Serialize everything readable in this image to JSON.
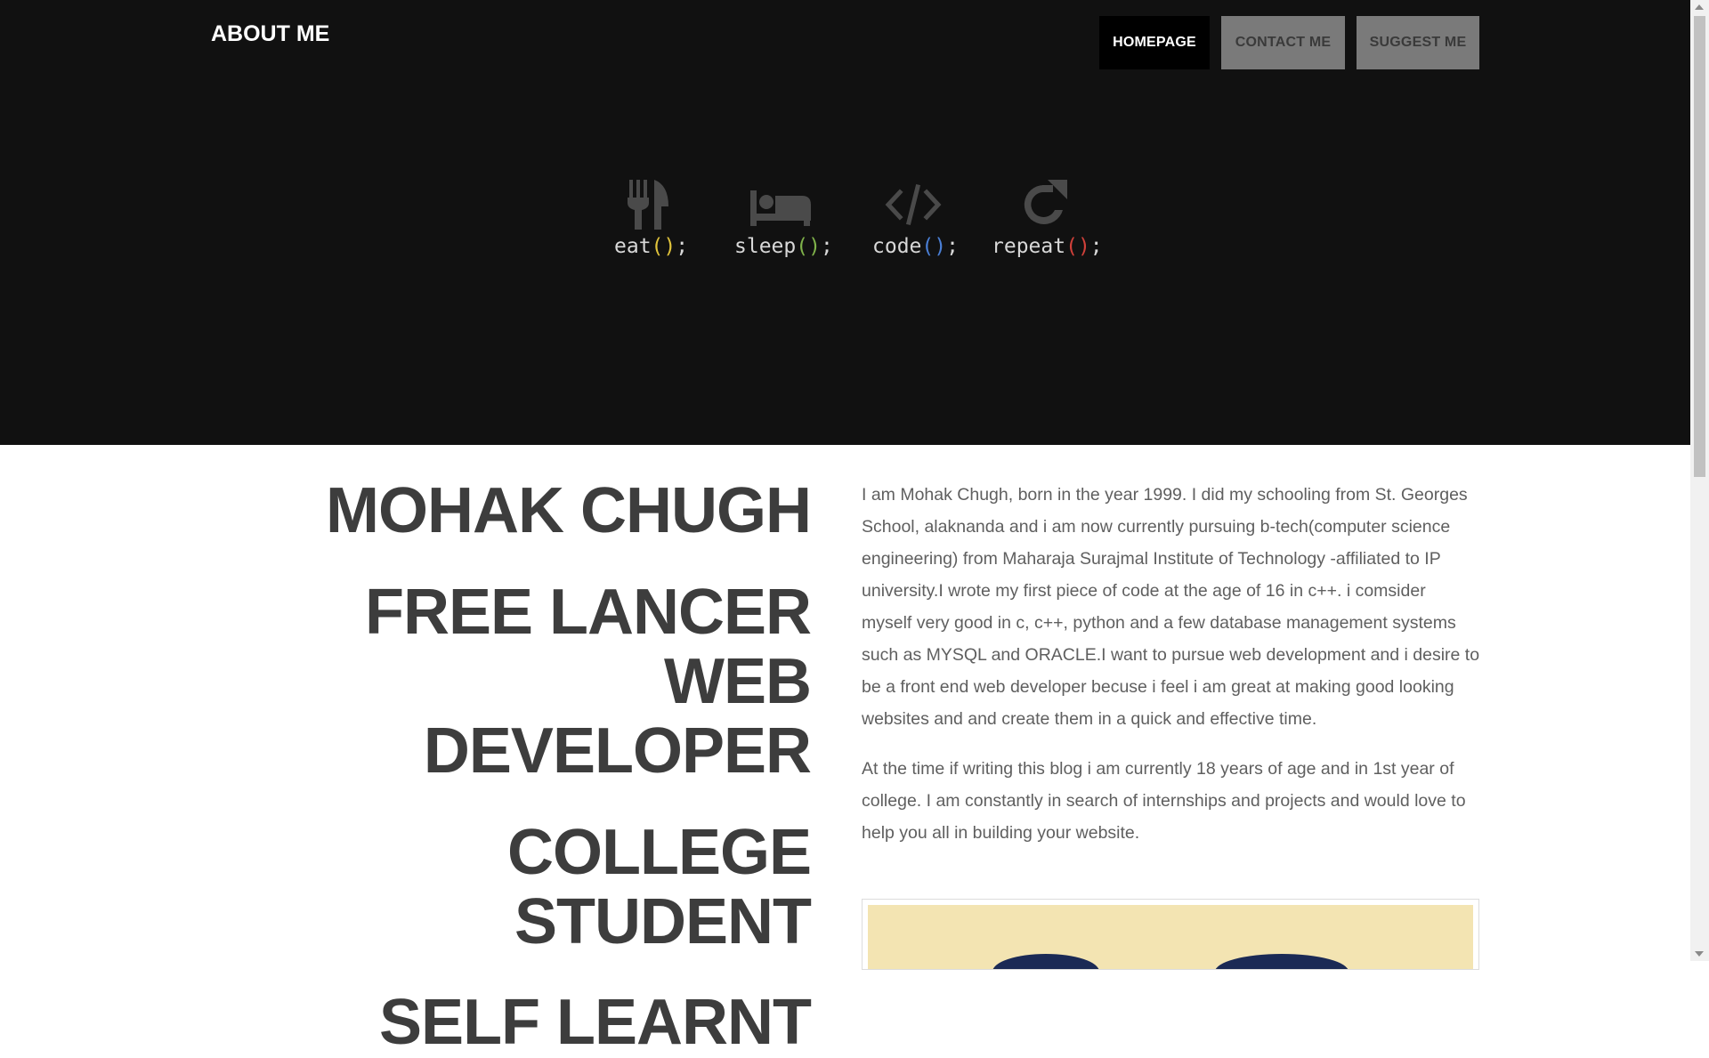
{
  "header": {
    "brand": "ABOUT ME",
    "nav": [
      {
        "label": "HOMEPAGE"
      },
      {
        "label": "CONTACT ME"
      },
      {
        "label": "SUGGEST ME"
      }
    ]
  },
  "routine": [
    {
      "name": "eat",
      "icon": "fork-knife-icon",
      "paren_color": "#e0c33b"
    },
    {
      "name": "sleep",
      "icon": "bed-icon",
      "paren_color": "#7fb24a"
    },
    {
      "name": "code",
      "icon": "code-icon",
      "paren_color": "#4a7fd6"
    },
    {
      "name": "repeat",
      "icon": "repeat-icon",
      "paren_color": "#d0403a"
    }
  ],
  "titles": {
    "name": "MOHAK CHUGH",
    "role_line1": "FREE LANCER WEB",
    "role_line2": "DEVELOPER",
    "status": "COLLEGE STUDENT",
    "learning": "SELF LEARNT"
  },
  "bio": {
    "paragraph1": "I am Mohak Chugh, born in the year 1999. I did my schooling from St. Georges School, alaknanda and i am now currently pursuing b-tech(computer science engineering) from Maharaja Surajmal Institute of Technology -affiliated to IP university.I wrote my first piece of code at the age of 16 in c++. i comsider myself very good in c, c++, python and a few database management systems such as MYSQL and ORACLE.I want to pursue web development and i desire to be a front end web developer becuse i feel i am great at making good looking websites and and create them in a quick and effective time.",
    "paragraph2": "At the time if writing this blog i am currently 18 years of age and in 1st year of college. I am constantly in search of internships and projects and would love to help you all in building your website."
  },
  "colors": {
    "hero_bg": "#111111",
    "title_text": "#3d3d3d",
    "body_text": "#5f5f5f",
    "nav_active_bg": "#000000",
    "nav_inactive_bg": "#7a7a7a"
  }
}
